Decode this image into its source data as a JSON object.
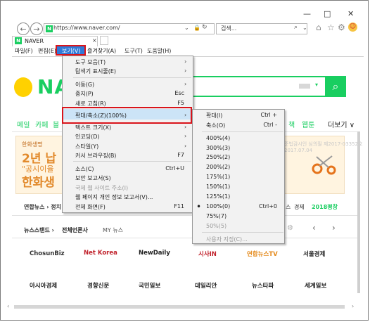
{
  "browser": {
    "url": "https://www.naver.com/",
    "search_placeholder": "검색...",
    "tab_title": "NAVER",
    "win_min": "—",
    "win_max": "□",
    "win_close": "✕"
  },
  "menubar": {
    "items": [
      "파일(F)",
      "편집(E)",
      "보기(V)",
      "즐겨찾기(A)",
      "도구(T)",
      "도움말(H)"
    ]
  },
  "page": {
    "logo": "NAVER",
    "nav": [
      "메일",
      "카페",
      "블"
    ],
    "nav_right": [
      "책",
      "웹툰",
      "더보기 ∨"
    ],
    "ad_brand": "한화생명",
    "ad_line1": "2년 납",
    "ad_line2": "\"공시이율",
    "ad_line3": "한화생",
    "ad_right": "준법감시인 심의필 제2017-03352호 2017.07.04",
    "news_label": "연합뉴스 › 정치",
    "news_right": [
      "스",
      "경제",
      "2018평창"
    ],
    "newsstand_tabs": [
      "뉴스스탠드 ›",
      "전체언론사",
      "MY 뉴스"
    ],
    "press_row1": [
      "ChosunBiz",
      "Net Korea",
      "NewDaily",
      "시사IN",
      "연합뉴스TV",
      "서울경제"
    ],
    "press_row2": [
      "아시아경제",
      "경향신문",
      "국민일보",
      "데일리안",
      "뉴스타파",
      "세계일보"
    ]
  },
  "view_menu": {
    "items": [
      {
        "label": "도구 모음(T)",
        "shortcut": "",
        "arrow": "›"
      },
      {
        "label": "탐색기 표시줄(E)",
        "shortcut": "",
        "arrow": "›"
      },
      {
        "label": "이동(G)",
        "shortcut": "",
        "arrow": "›"
      },
      {
        "label": "중지(P)",
        "shortcut": "Esc",
        "arrow": ""
      },
      {
        "label": "새로 고침(R)",
        "shortcut": "F5",
        "arrow": ""
      },
      {
        "label": "확대/축소(Z)(100%)",
        "shortcut": "",
        "arrow": "›"
      },
      {
        "label": "텍스트 크기(X)",
        "shortcut": "",
        "arrow": "›"
      },
      {
        "label": "인코딩(D)",
        "shortcut": "",
        "arrow": "›"
      },
      {
        "label": "스타일(Y)",
        "shortcut": "",
        "arrow": "›"
      },
      {
        "label": "커서 브라우징(B)",
        "shortcut": "F7",
        "arrow": ""
      },
      {
        "label": "소스(C)",
        "shortcut": "Ctrl+U",
        "arrow": ""
      },
      {
        "label": "보안 보고서(S)",
        "shortcut": "",
        "arrow": ""
      },
      {
        "label": "국제 웹 사이트 주소(I)",
        "shortcut": "",
        "arrow": ""
      },
      {
        "label": "웹 페이지 개인 정보 보고서(V)...",
        "shortcut": "",
        "arrow": ""
      },
      {
        "label": "전체 화면(F)",
        "shortcut": "F11",
        "arrow": ""
      }
    ]
  },
  "zoom_menu": {
    "items": [
      {
        "label": "확대(I)",
        "shortcut": "Ctrl +"
      },
      {
        "label": "축소(O)",
        "shortcut": "Ctrl -"
      },
      {
        "label": "400%(4)",
        "shortcut": ""
      },
      {
        "label": "300%(3)",
        "shortcut": ""
      },
      {
        "label": "250%(2)",
        "shortcut": ""
      },
      {
        "label": "200%(2)",
        "shortcut": ""
      },
      {
        "label": "175%(1)",
        "shortcut": ""
      },
      {
        "label": "150%(1)",
        "shortcut": ""
      },
      {
        "label": "125%(1)",
        "shortcut": ""
      },
      {
        "label": "100%(0)",
        "shortcut": "Ctrl+0"
      },
      {
        "label": "75%(7)",
        "shortcut": ""
      },
      {
        "label": "50%(5)",
        "shortcut": ""
      },
      {
        "label": "사용자 지정(C)...",
        "shortcut": ""
      }
    ],
    "selected_bullet": "•"
  },
  "colors": {
    "accent_red": "#d9141b",
    "highlight": "#cce4f7",
    "naver_green": "#19ce60"
  }
}
